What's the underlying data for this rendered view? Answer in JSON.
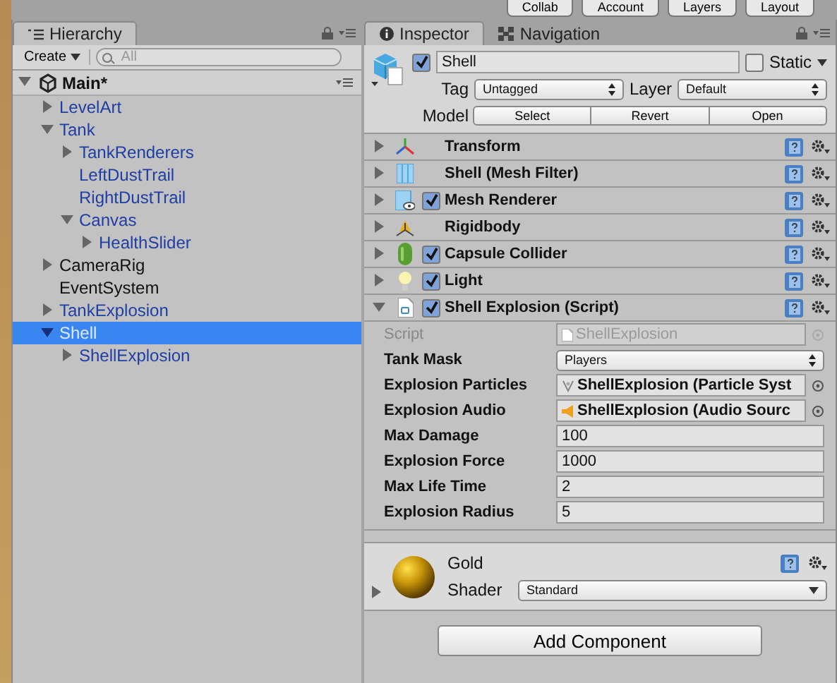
{
  "toolbar": {
    "buttons": [
      "Collab",
      "Account",
      "Layers",
      "Layout"
    ]
  },
  "hierarchy": {
    "tab": "Hierarchy",
    "create": "Create",
    "search_placeholder": "All",
    "scene": {
      "name": "Main*",
      "expanded": true
    },
    "items": [
      {
        "name": "LevelArt",
        "prefab": true,
        "expanded": false,
        "selected": false
      },
      {
        "name": "Tank",
        "prefab": true,
        "expanded": true,
        "selected": false,
        "children": [
          {
            "name": "TankRenderers",
            "prefab": true,
            "expanded": false,
            "selected": false
          },
          {
            "name": "LeftDustTrail",
            "prefab": true,
            "selected": false
          },
          {
            "name": "RightDustTrail",
            "prefab": true,
            "selected": false
          },
          {
            "name": "Canvas",
            "prefab": true,
            "expanded": true,
            "selected": false,
            "children": [
              {
                "name": "HealthSlider",
                "prefab": true,
                "expanded": false,
                "selected": false
              }
            ]
          }
        ]
      },
      {
        "name": "CameraRig",
        "prefab": false,
        "expanded": false,
        "selected": false
      },
      {
        "name": "EventSystem",
        "prefab": false,
        "selected": false
      },
      {
        "name": "TankExplosion",
        "prefab": true,
        "expanded": false,
        "selected": false
      },
      {
        "name": "Shell",
        "prefab": true,
        "expanded": true,
        "selected": true,
        "children": [
          {
            "name": "ShellExplosion",
            "prefab": true,
            "expanded": false,
            "selected": false
          }
        ]
      }
    ]
  },
  "inspector": {
    "tabs": [
      {
        "label": "Inspector",
        "selected": true
      },
      {
        "label": "Navigation",
        "selected": false
      }
    ],
    "object": {
      "active": true,
      "name": "Shell",
      "static": false,
      "static_label": "Static",
      "tag_label": "Tag",
      "tag": "Untagged",
      "layer_label": "Layer",
      "layer": "Default",
      "model_label": "Model",
      "model_buttons": [
        "Select",
        "Revert",
        "Open"
      ]
    },
    "components": [
      {
        "name": "Transform",
        "kind": "transform",
        "expanded": false
      },
      {
        "name": "Shell (Mesh Filter)",
        "kind": "mesh-filter",
        "expanded": false
      },
      {
        "name": "Mesh Renderer",
        "kind": "mesh-renderer",
        "enabled": true,
        "expanded": false
      },
      {
        "name": "Rigidbody",
        "kind": "rigidbody",
        "expanded": false
      },
      {
        "name": "Capsule Collider",
        "kind": "capsule",
        "enabled": true,
        "expanded": false
      },
      {
        "name": "Light",
        "kind": "light",
        "enabled": true,
        "expanded": false
      },
      {
        "name": "Shell Explosion (Script)",
        "kind": "script",
        "enabled": true,
        "expanded": true,
        "fields": [
          {
            "kind": "script",
            "label": "Script",
            "value": "ShellExplosion",
            "disabled": true
          },
          {
            "kind": "dropdown",
            "label": "Tank Mask",
            "value": "Players"
          },
          {
            "kind": "particles",
            "label": "Explosion Particles",
            "value": "ShellExplosion (Particle Syst"
          },
          {
            "kind": "audio",
            "label": "Explosion Audio",
            "value": "ShellExplosion (Audio Sourc"
          },
          {
            "kind": "number",
            "label": "Max Damage",
            "value": "100"
          },
          {
            "kind": "number",
            "label": "Explosion Force",
            "value": "1000"
          },
          {
            "kind": "number",
            "label": "Max Life Time",
            "value": "2"
          },
          {
            "kind": "number",
            "label": "Explosion Radius",
            "value": "5"
          }
        ]
      }
    ],
    "material": {
      "name": "Gold",
      "shader_label": "Shader",
      "shader": "Standard",
      "expanded": false
    },
    "add_component": "Add Component"
  }
}
